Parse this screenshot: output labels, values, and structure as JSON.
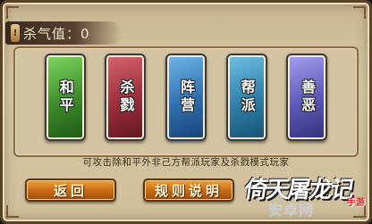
{
  "header": {
    "title_icon_glyph": "!",
    "title": "杀气值：0"
  },
  "modes": [
    {
      "id": "he",
      "label": "和平"
    },
    {
      "id": "sha",
      "label": "杀戮"
    },
    {
      "id": "zhen",
      "label": "阵营"
    },
    {
      "id": "bang",
      "label": "帮派"
    },
    {
      "id": "shan",
      "label": "善恶"
    }
  ],
  "description": "可攻击除和平外非己方帮派玩家及杀戮模式玩家",
  "buttons": {
    "back": "返回",
    "rules": "规则说明"
  },
  "logo": {
    "title": "倚天屠龙记",
    "subtitle": "手游"
  },
  "watermark": "安卓网",
  "colors": {
    "peace": "#3c8a2a",
    "kill": "#9a2e3a",
    "faction": "#2f6fae",
    "guild": "#2d7fa8",
    "goodevil": "#5c57b6"
  }
}
